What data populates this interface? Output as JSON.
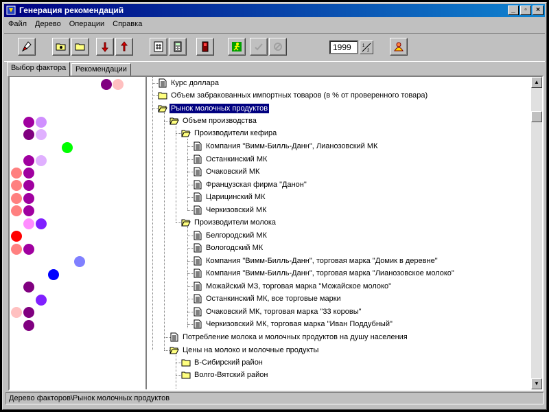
{
  "window": {
    "title": "Генерация рекомендаций"
  },
  "title_buttons": {
    "minimize": "_",
    "maximize": "▫",
    "close": "×"
  },
  "menu": [
    "Файл",
    "Дерево",
    "Операции",
    "Справка"
  ],
  "toolbar": {
    "year_value": "1999",
    "buttons": [
      "broom-icon",
      "open-folder-icon",
      "folder-icon",
      "arrow-down-icon",
      "arrow-up-icon",
      "hash-document-icon",
      "calculator-icon",
      "phone-icon",
      "run-icon",
      "check-icon",
      "cancel-icon",
      "people-icon"
    ]
  },
  "tabs": [
    "Выбор фактора",
    "Рекомендации"
  ],
  "colors": {
    "dots": [
      "#800080",
      "#ffc0c0",
      "#a000a0",
      "#d090ff",
      "#800080",
      "#e0b0ff",
      "#00ff00",
      "#a000a0",
      "#e0b0ff",
      "#ff8080",
      "#a000a0",
      "#ff8080",
      "#a000a0",
      "#ff8080",
      "#a000a0",
      "#ff8080",
      "#a000a0",
      "#ff8cff",
      "#8020ff",
      "#ff0000",
      "#ff8080",
      "#a000a0",
      "#8080ff",
      "#0000ff",
      "#800080",
      "#8020ff",
      "#ffc0c0",
      "#800080",
      "#800080"
    ]
  },
  "tree": {
    "n0": "Курс доллара",
    "n1": "Объем забракованных импортных товаров (в % от проверенного товара)",
    "n2": "Рынок молочных продуктов",
    "n3": "Объем производства",
    "n4": "Производители кефира",
    "n5": "Компания \"Вимм-Билль-Данн\", Лианозовский МК",
    "n6": "Останкинский МК",
    "n7": "Очаковский МК",
    "n8": "Французская фирма \"Данон\"",
    "n9": "Царицинский МК",
    "n10": "Черкизовский МК",
    "n11": "Производители молока",
    "n12": "Белгородский МК",
    "n13": "Вологодский МК",
    "n14": "Компания \"Вимм-Билль-Данн\", торговая марка \"Домик в деревне\"",
    "n15": "Компания \"Вимм-Билль-Данн\", торговая марка \"Лианозовское молоко\"",
    "n16": "Можайский МЗ, торговая марка \"Можайское молоко\"",
    "n17": "Останкинский МК, все торговые марки",
    "n18": "Очаковский МК, торговая марка \"33 коровы\"",
    "n19": "Черкизовский МК, торговая марка \"Иван Поддубный\"",
    "n20": "Потребление молока и молочных продуктов на душу населения",
    "n21": "Цены на молоко и молочные продукты",
    "n22": "В-Сибирский район",
    "n23": "Волго-Вятский район"
  },
  "status": {
    "path": "Дерево факторов\\Рынок молочных продуктов"
  }
}
